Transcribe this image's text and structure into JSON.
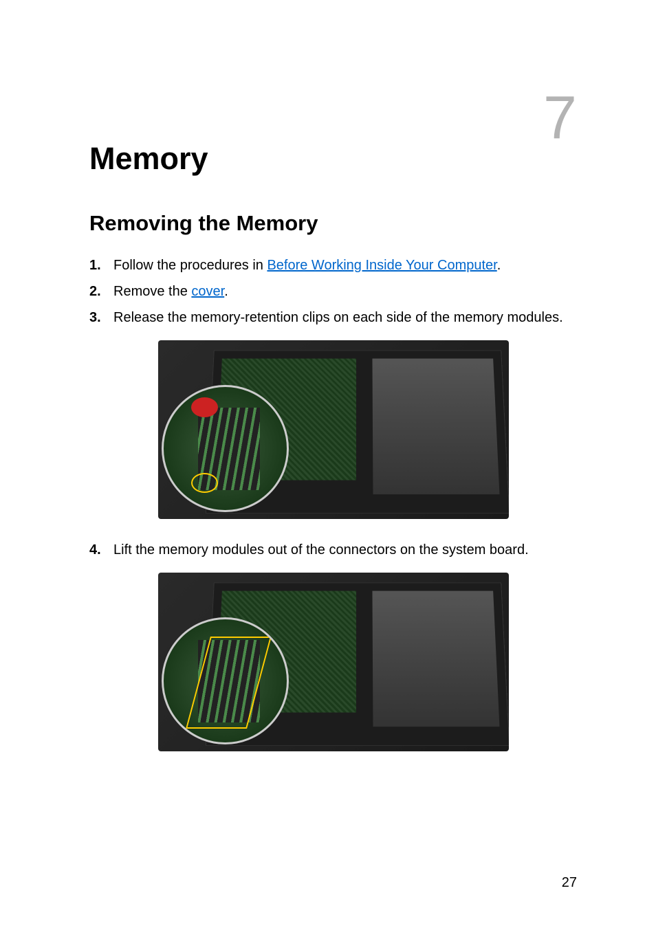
{
  "chapter": {
    "number": "7",
    "title": "Memory"
  },
  "section": {
    "heading": "Removing the Memory"
  },
  "steps": [
    {
      "num": "1.",
      "text_before": "Follow the procedures in ",
      "link": "Before Working Inside Your Computer",
      "text_after": "."
    },
    {
      "num": "2.",
      "text_before": "Remove the ",
      "link": "cover",
      "text_after": "."
    },
    {
      "num": "3.",
      "text_before": "Release the memory-retention clips on each side of the memory modules.",
      "link": "",
      "text_after": ""
    },
    {
      "num": "4.",
      "text_before": "Lift the memory modules out of the connectors on the system board.",
      "link": "",
      "text_after": ""
    }
  ],
  "page_number": "27"
}
